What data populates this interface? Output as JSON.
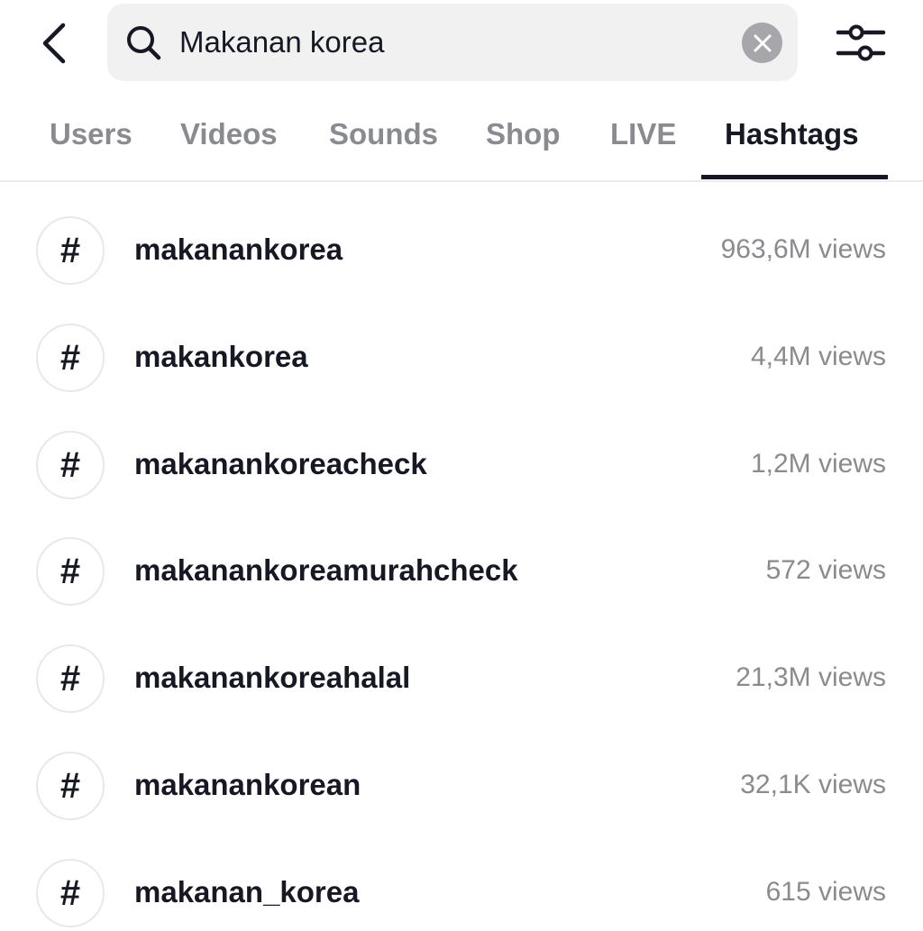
{
  "search": {
    "query": "Makanan korea",
    "back_icon": "chevron-left-icon",
    "search_icon": "magnifier-icon",
    "clear_icon": "close-circle-icon",
    "filter_icon": "sliders-icon"
  },
  "tabs": [
    {
      "label": "Users",
      "active": false
    },
    {
      "label": "Videos",
      "active": false
    },
    {
      "label": "Sounds",
      "active": false
    },
    {
      "label": "Shop",
      "active": false
    },
    {
      "label": "LIVE",
      "active": false
    },
    {
      "label": "Hashtags",
      "active": true
    }
  ],
  "hashtags": [
    {
      "symbol": "#",
      "name": "makanankorea",
      "views": "963,6M views"
    },
    {
      "symbol": "#",
      "name": "makankorea",
      "views": "4,4M views"
    },
    {
      "symbol": "#",
      "name": "makanankoreacheck",
      "views": "1,2M views"
    },
    {
      "symbol": "#",
      "name": "makanankoreamurahcheck",
      "views": "572 views"
    },
    {
      "symbol": "#",
      "name": "makanankoreahalal",
      "views": "21,3M views"
    },
    {
      "symbol": "#",
      "name": "makanankorean",
      "views": "32,1K views"
    },
    {
      "symbol": "#",
      "name": "makanan_korea",
      "views": "615 views"
    }
  ],
  "colors": {
    "primary_text": "#161823",
    "secondary_text": "#8a8b91",
    "search_bg": "#f1f1f2",
    "clear_button_bg": "#a7a7ab"
  }
}
